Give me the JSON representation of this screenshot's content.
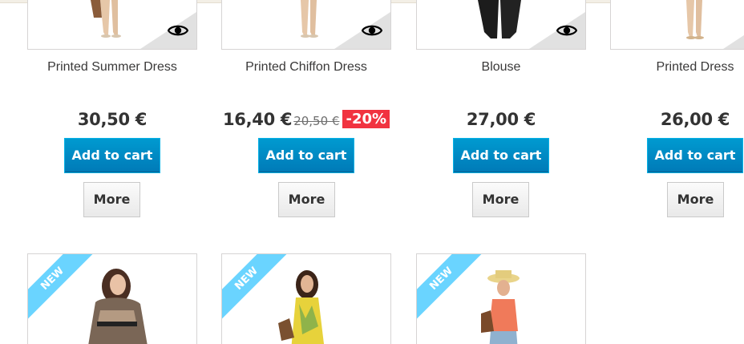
{
  "products": [
    {
      "name": "Printed Summer Dress",
      "price": "30,50 €",
      "old_price": "",
      "discount": "",
      "cart_label": "Add to cart",
      "more_label": "More",
      "has_quick_view": true
    },
    {
      "name": "Printed Chiffon Dress",
      "price": "16,40 €",
      "old_price": "20,50 €",
      "discount": "-20%",
      "cart_label": "Add to cart",
      "more_label": "More",
      "has_quick_view": true
    },
    {
      "name": "Blouse",
      "price": "27,00 €",
      "old_price": "",
      "discount": "",
      "cart_label": "Add to cart",
      "more_label": "More",
      "has_quick_view": true
    },
    {
      "name": "Printed Dress",
      "price": "26,00 €",
      "old_price": "",
      "discount": "",
      "cart_label": "Add to cart",
      "more_label": "More",
      "has_quick_view": true
    }
  ],
  "new_products": [
    {
      "badge": "NEW"
    },
    {
      "badge": "NEW"
    },
    {
      "badge": "NEW"
    }
  ],
  "colors": {
    "cart_button": "#0079b6",
    "discount_badge": "#f13340",
    "new_ribbon": "#6ad4ff"
  },
  "icons": {
    "quick_view": "eye-icon"
  }
}
